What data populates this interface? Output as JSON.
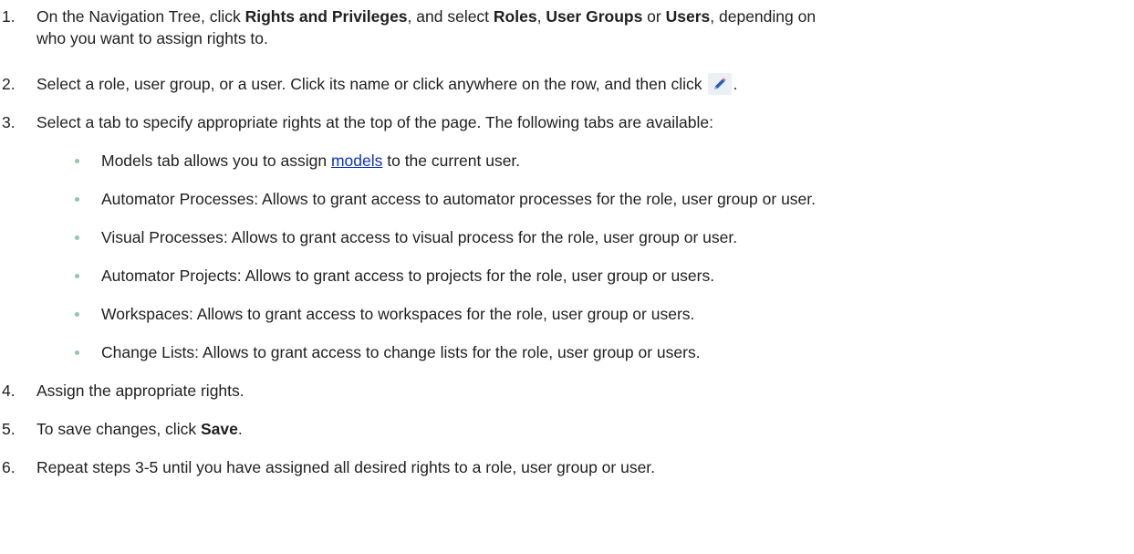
{
  "steps": [
    {
      "num": "1.",
      "t1": "On the Navigation Tree, click ",
      "b1": "Rights and Privileges",
      "t2": ", and select ",
      "b2": "Roles",
      "t3": ", ",
      "b3": "User Groups",
      "t4": " or ",
      "b4": "Users",
      "t5": ", depending on",
      "line2": "who you want to assign rights to."
    },
    {
      "num": "2.",
      "t1": "Select a role, user group, or a user. Click its name or click anywhere on the row, and then click",
      "t2": ".",
      "icon": "pencil-edit-icon"
    },
    {
      "num": "3.",
      "text": "Select a tab to specify appropriate rights at the top of the page. The following tabs are available:"
    },
    {
      "num": "4.",
      "text": "Assign the appropriate rights."
    },
    {
      "num": "5.",
      "t1": "To save changes, click ",
      "b1": "Save",
      "t2": "."
    },
    {
      "num": "6.",
      "text": "Repeat steps 3-5 until you have assigned all desired rights to a role, user group or user."
    }
  ],
  "tabs": {
    "models_pre": "Models tab allows you to assign ",
    "models_link": "models",
    "models_post": " to the current user.",
    "automator_processes": "Automator Processes: Allows to grant access to automator processes for the role, user group or user.",
    "visual_processes": "Visual Processes: Allows to grant access to visual process for the role, user group or user.",
    "automator_projects": "Automator Projects: Allows to grant access to projects for the role, user group or users.",
    "workspaces": "Workspaces: Allows to grant access to workspaces for the role, user group or users.",
    "change_lists": "Change Lists: Allows to grant access to change lists for the role, user group or users."
  },
  "colors": {
    "text": "#1f1f1f",
    "link": "#0b32c4",
    "bullet": "#8fc7a8",
    "icon_bg": "#eaf0f6",
    "icon_pencil": "#2a5db8"
  }
}
